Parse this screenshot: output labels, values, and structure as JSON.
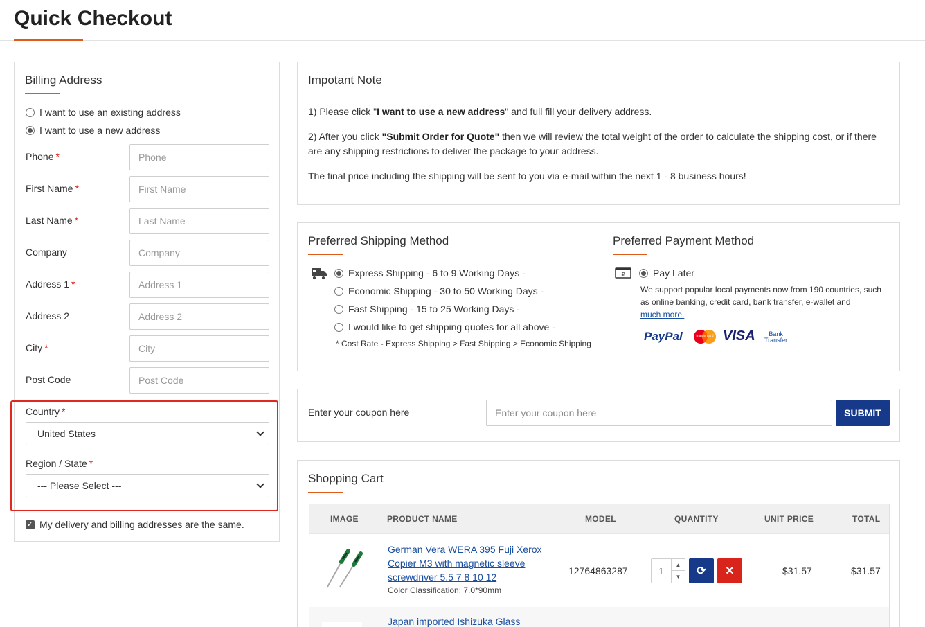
{
  "page": {
    "title": "Quick Checkout"
  },
  "billing": {
    "title": "Billing Address",
    "options": [
      "I want to use an existing address",
      "I want to use a new address"
    ],
    "fields": [
      {
        "label": "Phone",
        "placeholder": "Phone",
        "required": "*"
      },
      {
        "label": "First Name",
        "placeholder": "First Name",
        "required": "*"
      },
      {
        "label": "Last Name",
        "placeholder": "Last Name",
        "required": "*"
      },
      {
        "label": "Company",
        "placeholder": "Company",
        "required": ""
      },
      {
        "label": "Address 1",
        "placeholder": "Address 1",
        "required": "*"
      },
      {
        "label": "Address 2",
        "placeholder": "Address 2",
        "required": ""
      },
      {
        "label": "City",
        "placeholder": "City",
        "required": "*"
      },
      {
        "label": "Post Code",
        "placeholder": "Post Code",
        "required": ""
      }
    ],
    "country": {
      "label": "Country",
      "required": "*",
      "value": "United States"
    },
    "region": {
      "label": "Region / State",
      "required": "*",
      "value": "--- Please Select ---"
    },
    "same_address": "My delivery and billing addresses are the same."
  },
  "note": {
    "title": "Impotant Note",
    "p1_pre": "1) Please click \"",
    "p1_bold": "I want to use a new address",
    "p1_post": "\" and full fill your delivery address.",
    "p2_pre": "2) After you click ",
    "p2_bold": "\"Submit Order for Quote\"",
    "p2_post": " then we will review the total weight of the order to calculate the shipping cost, or if there are any shipping restrictions to deliver the package to your address.",
    "p3": "The final price including the shipping will be sent to you via e-mail within the next 1 - 8 business hours!"
  },
  "shipping": {
    "title": "Preferred Shipping Method",
    "options": [
      "Express Shipping - 6 to 9 Working Days -",
      "Economic Shipping - 30 to 50 Working Days -",
      "Fast Shipping - 15 to 25 Working Days -",
      "I would like to get shipping quotes for all above -"
    ],
    "note": "* Cost Rate - Express Shipping > Fast Shipping > Economic Shipping"
  },
  "payment": {
    "title": "Preferred Payment Method",
    "option": "Pay Later",
    "desc": "We support popular local payments now from 190 countries, such as online banking, credit card, bank transfer, e-wallet and",
    "link": "much more.",
    "logos": {
      "paypal": "PayPal",
      "mastercard": "mastercard",
      "visa": "VISA",
      "bank_1": "Bank",
      "bank_2": "Transfer"
    }
  },
  "coupon": {
    "label": "Enter your coupon here",
    "placeholder": "Enter your coupon here",
    "submit": "SUBMIT"
  },
  "cart": {
    "title": "Shopping Cart",
    "headers": {
      "image": "IMAGE",
      "product": "PRODUCT NAME",
      "model": "MODEL",
      "quantity": "QUANTITY",
      "unit_price": "UNIT PRICE",
      "total": "TOTAL"
    },
    "items": [
      {
        "name": "German Vera WERA 395 Fuji Xerox Copier M3 with magnetic sleeve screwdriver 5.5 7 8 10 12",
        "option": "Color Classification: 7.0*90mm",
        "model": "12764863287",
        "quantity": "1",
        "unit_price": "$31.57",
        "total": "$31.57"
      },
      {
        "name": "Japan imported Ishizuka Glass"
      }
    ]
  },
  "colors": {
    "accent": "#e05b1a",
    "primary": "#17398a",
    "danger": "#d9241c",
    "link": "#1a4fa0"
  }
}
